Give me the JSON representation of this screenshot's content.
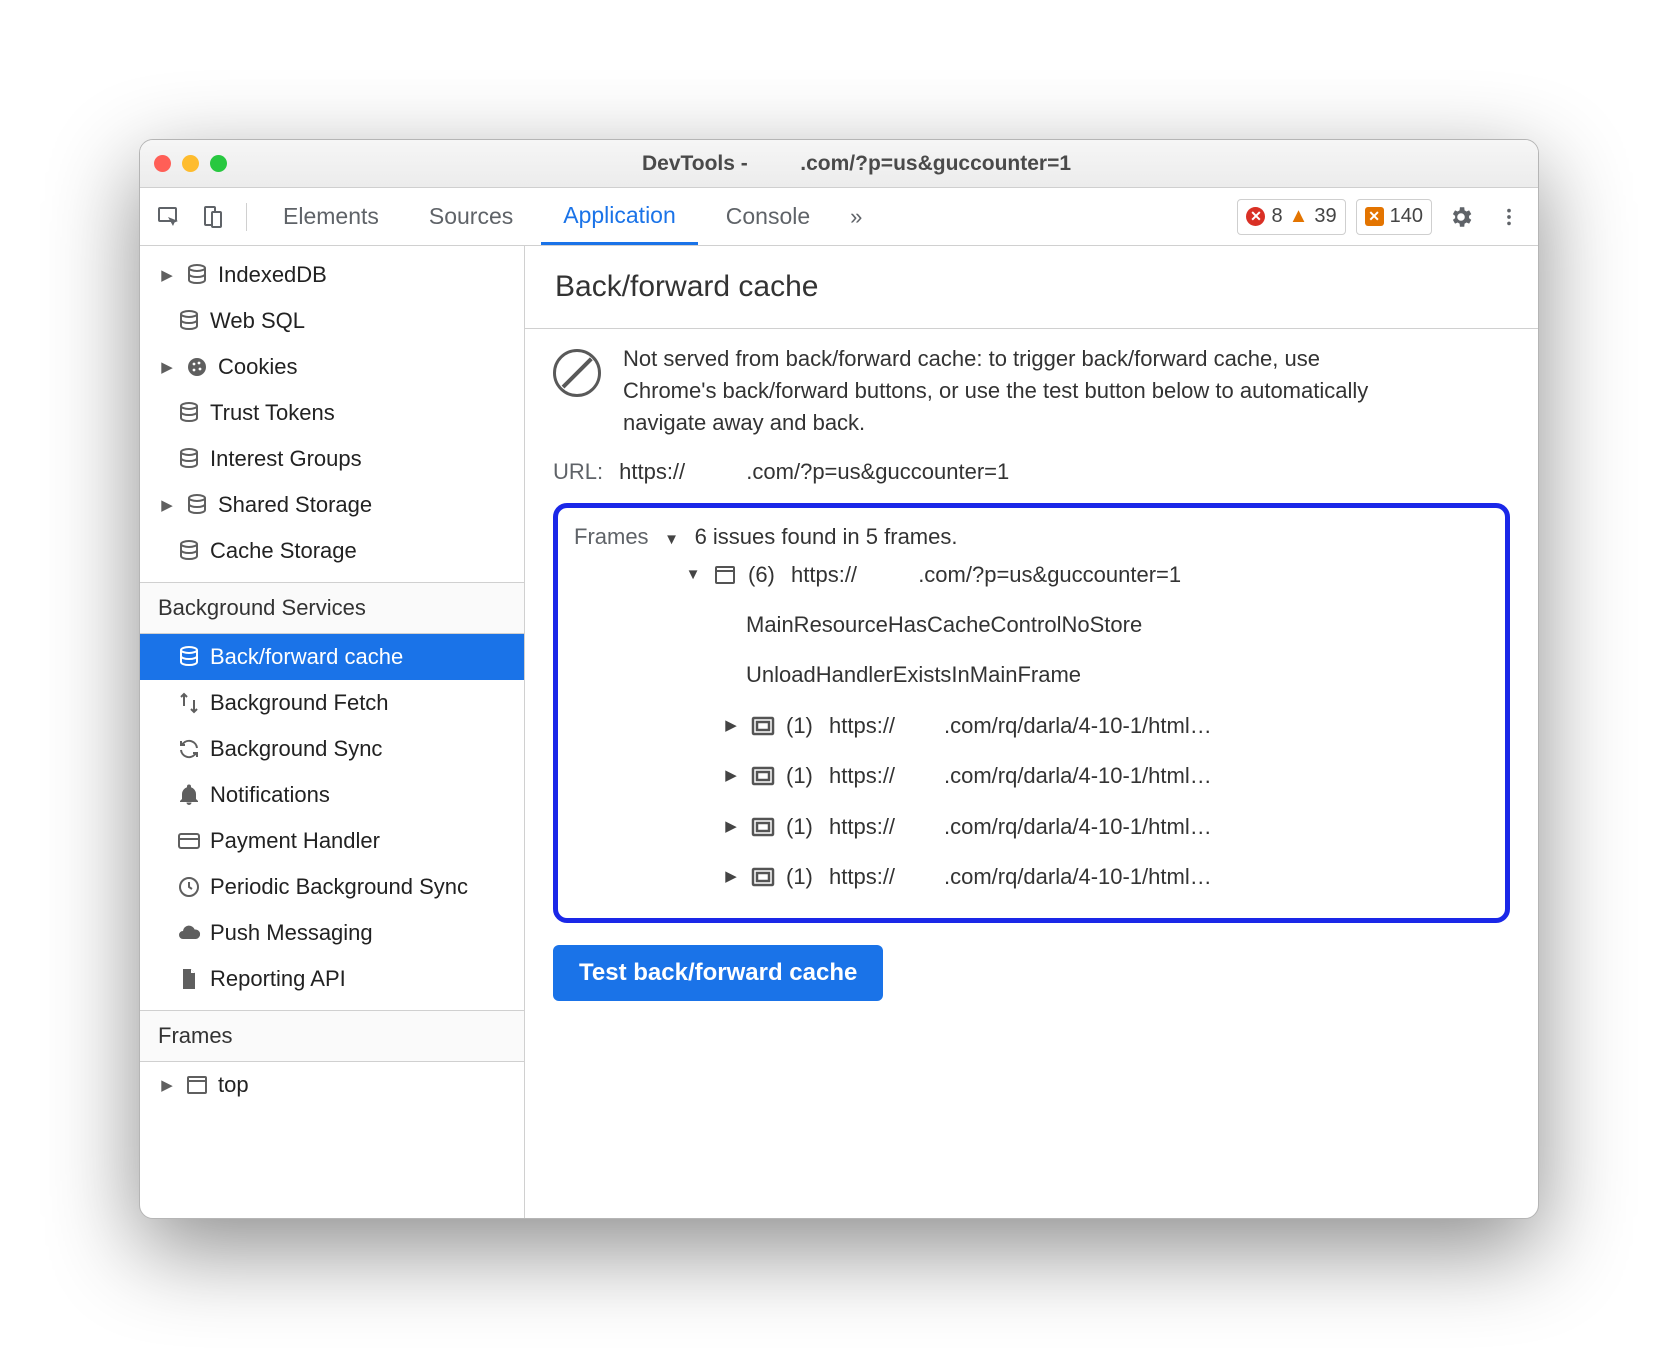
{
  "title_prefix": "DevTools - ",
  "title_suffix": ".com/?p=us&guccounter=1",
  "tabs": {
    "elements": "Elements",
    "sources": "Sources",
    "application": "Application",
    "console": "Console"
  },
  "badges": {
    "errors": "8",
    "warnings": "39",
    "issues": "140"
  },
  "storage": {
    "indexeddb": "IndexedDB",
    "websql": "Web SQL",
    "cookies": "Cookies",
    "trust": "Trust Tokens",
    "interest": "Interest Groups",
    "shared": "Shared Storage",
    "cache": "Cache Storage"
  },
  "sections": {
    "bg": "Background Services",
    "frames": "Frames"
  },
  "bg": {
    "bfcache": "Back/forward cache",
    "bgfetch": "Background Fetch",
    "bgsync": "Background Sync",
    "notif": "Notifications",
    "payment": "Payment Handler",
    "periodic": "Periodic Background Sync",
    "push": "Push Messaging",
    "reporting": "Reporting API"
  },
  "frames_top": "top",
  "panel": {
    "title": "Back/forward cache",
    "info": "Not served from back/forward cache: to trigger back/forward cache, use Chrome's back/forward buttons, or use the test button below to automatically navigate away and back.",
    "url_label": "URL:",
    "url_prefix": "https://",
    "url_suffix": ".com/?p=us&guccounter=1",
    "frames_label": "Frames",
    "frames_summary": "6 issues found in 5 frames.",
    "root_count": "(6)",
    "root_prefix": "https://",
    "root_suffix": ".com/?p=us&guccounter=1",
    "reason1": "MainResourceHasCacheControlNoStore",
    "reason2": "UnloadHandlerExistsInMainFrame",
    "child_count": "(1)",
    "child_prefix": "https://",
    "child_suffix": ".com/rq/darla/4-10-1/html…",
    "button": "Test back/forward cache"
  }
}
